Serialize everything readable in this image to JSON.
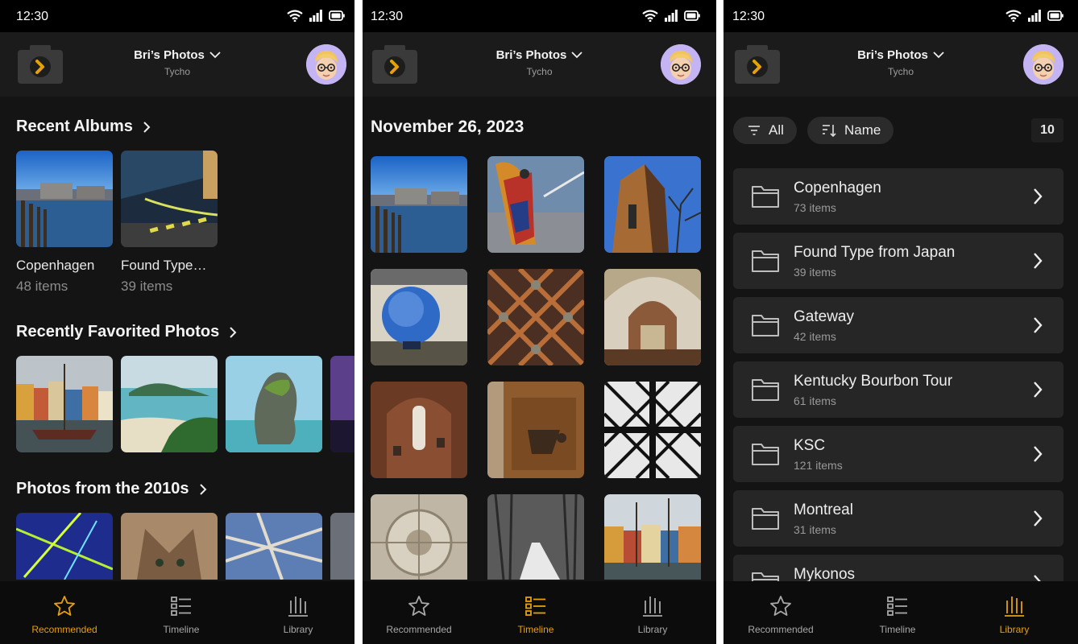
{
  "status": {
    "time": "12:30"
  },
  "header": {
    "account_name": "Bri’s Photos",
    "account_sub": "Tycho"
  },
  "nav": {
    "recommended": "Recommended",
    "timeline": "Timeline",
    "library": "Library"
  },
  "recommended": {
    "recent_albums_title": "Recent Albums",
    "albums": [
      {
        "name": "Copenhagen",
        "count": "48 items"
      },
      {
        "name": "Found Type…",
        "count": "39 items"
      }
    ],
    "favorites_title": "Recently Favorited Photos",
    "decade_title": "Photos from the 2010s"
  },
  "timeline": {
    "date": "November 26, 2023"
  },
  "library": {
    "filter_label": "All",
    "sort_label": "Name",
    "total": "10",
    "albums": [
      {
        "name": "Copenhagen",
        "count": "73 items"
      },
      {
        "name": "Found Type from Japan",
        "count": "39 items"
      },
      {
        "name": "Gateway",
        "count": "42 items"
      },
      {
        "name": "Kentucky Bourbon Tour",
        "count": "61 items"
      },
      {
        "name": "KSC",
        "count": "121 items"
      },
      {
        "name": "Montreal",
        "count": "31 items"
      },
      {
        "name": "Mykonos",
        "count": ""
      }
    ]
  },
  "colors": {
    "accent": "#e5a00d",
    "background": "#141414",
    "row": "#262626"
  }
}
